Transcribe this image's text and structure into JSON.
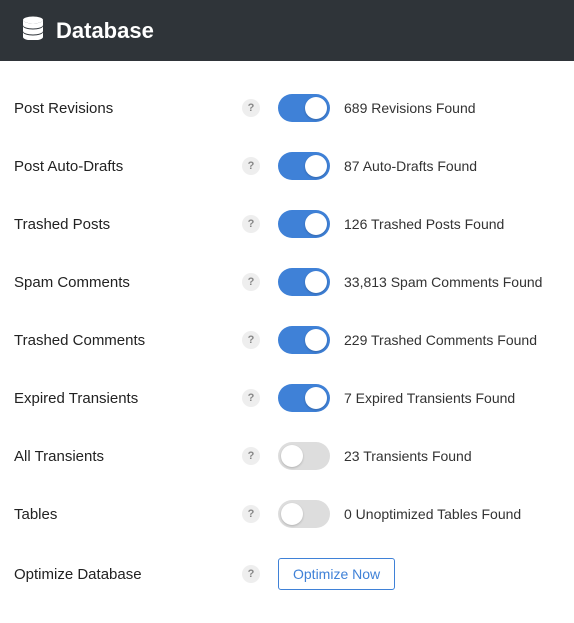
{
  "header": {
    "title": "Database"
  },
  "rows": {
    "postRevisions": {
      "label": "Post Revisions",
      "enabled": true,
      "status": "689 Revisions Found"
    },
    "postAutoDrafts": {
      "label": "Post Auto-Drafts",
      "enabled": true,
      "status": "87 Auto-Drafts Found"
    },
    "trashedPosts": {
      "label": "Trashed Posts",
      "enabled": true,
      "status": "126 Trashed Posts Found"
    },
    "spamComments": {
      "label": "Spam Comments",
      "enabled": true,
      "status": "33,813 Spam Comments Found"
    },
    "trashedComments": {
      "label": "Trashed Comments",
      "enabled": true,
      "status": "229 Trashed Comments Found"
    },
    "expiredTransients": {
      "label": "Expired Transients",
      "enabled": true,
      "status": "7 Expired Transients Found"
    },
    "allTransients": {
      "label": "All Transients",
      "enabled": false,
      "status": "23 Transients Found"
    },
    "tables": {
      "label": "Tables",
      "enabled": false,
      "status": "0 Unoptimized Tables Found"
    }
  },
  "optimize": {
    "label": "Optimize Database",
    "button": "Optimize Now"
  },
  "help": "?"
}
